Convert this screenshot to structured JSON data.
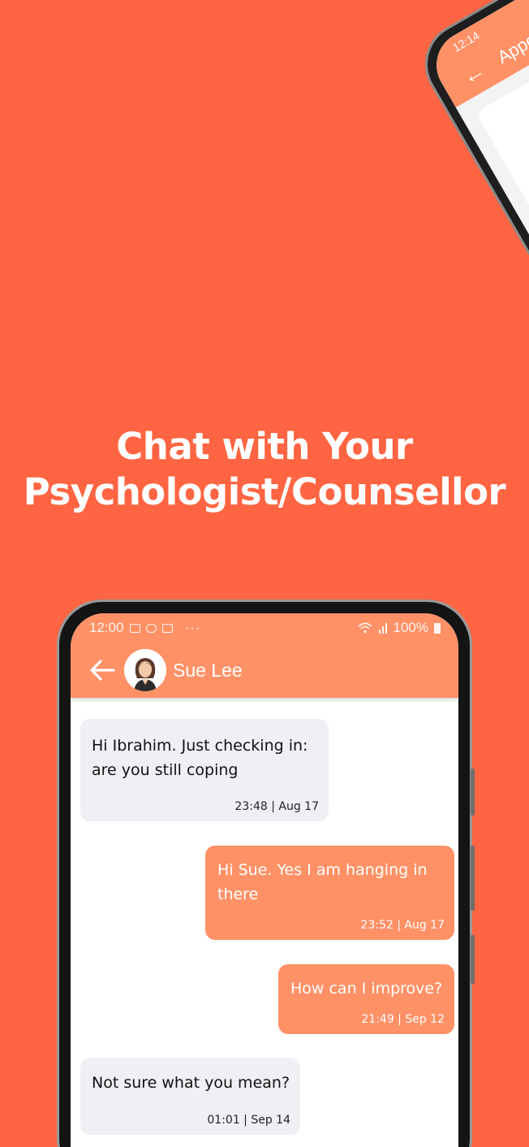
{
  "headline": {
    "line1": "Chat with Your",
    "line2": "Psychologist/Counsellor"
  },
  "background_color": "#FF6542",
  "accent_color": "#FF9166",
  "tilted_phone": {
    "status_time": "12:14",
    "header_title": "Appoi",
    "back_icon": "arrow-left-icon"
  },
  "phone": {
    "status_bar": {
      "time": "12:00",
      "more": "···",
      "battery": "100%",
      "icons": [
        "image-icon",
        "cloud-icon",
        "calendar-icon",
        "wifi-icon",
        "signal-icon",
        "battery-icon"
      ]
    },
    "header": {
      "contact_name": "Sue Lee",
      "back_icon": "arrow-left-icon"
    },
    "messages": [
      {
        "direction": "incoming",
        "text": "Hi Ibrahim. Just checking in: are you still coping",
        "time": "23:48 | Aug 17"
      },
      {
        "direction": "outgoing",
        "text": "Hi Sue. Yes I am hanging in there",
        "time": "23:52 | Aug 17"
      },
      {
        "direction": "outgoing",
        "text": "How can I improve?",
        "time": "21:49 | Sep 12"
      },
      {
        "direction": "incoming",
        "text": "Not sure what you mean?",
        "time": "01:01 | Sep 14"
      }
    ]
  }
}
